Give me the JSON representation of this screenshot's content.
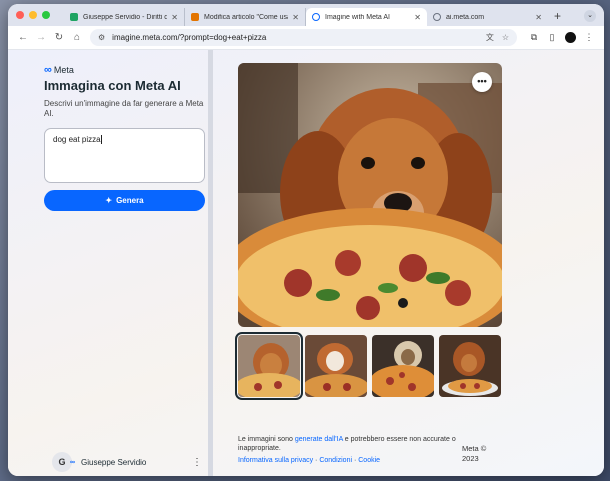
{
  "tabs": [
    {
      "label": "Giuseppe Servidio - Diritti d'autore",
      "active": false,
      "favicon_color": "#1fa463"
    },
    {
      "label": "Modifica articolo \"Come usare Meta AI\"",
      "active": false,
      "favicon_color": "#e37400"
    },
    {
      "label": "Imagine with Meta AI",
      "active": true,
      "favicon_color": "#0866ff"
    },
    {
      "label": "ai.meta.com",
      "active": false,
      "favicon_color": "#6b7280"
    }
  ],
  "toolbar": {
    "url": "imagine.meta.com/?prompt=dog+eat+pizza"
  },
  "sidebar": {
    "brand": "Meta",
    "heading": "Immagina con Meta AI",
    "description": "Descrivi un'immagine da far generare a Meta AI.",
    "prompt_value": "dog eat pizza",
    "generate_label": "Genera",
    "user_name": "Giuseppe Servidio",
    "user_initial": "G"
  },
  "footer": {
    "disclaimer_pre": "Le immagini sono ",
    "disclaimer_link": "generate dall'IA",
    "disclaimer_post": " e potrebbero essere non accurate o inappropriate.",
    "privacy": "Informativa sulla privacy",
    "terms": "Condizioni",
    "cookie": "Cookie",
    "sep": " · ",
    "copyright": "Meta © 2023"
  },
  "colors": {
    "accent": "#0866ff",
    "text": "#1c2b33"
  }
}
